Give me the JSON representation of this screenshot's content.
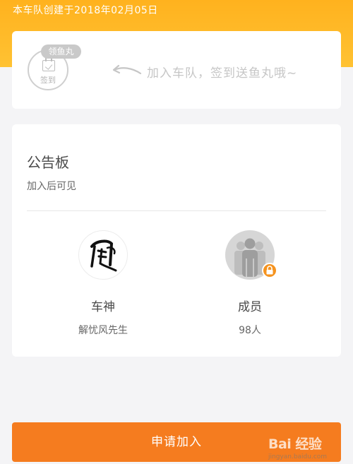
{
  "header": {
    "created_text": "本车队创建于2018年02月05日"
  },
  "checkin": {
    "badge_label": "领鱼丸",
    "icon_label": "签到",
    "hint_text": "加入车队，签到送鱼丸哦~"
  },
  "board": {
    "title": "公告板",
    "subtitle": "加入后可见"
  },
  "stats": {
    "owner": {
      "title": "车神",
      "value": "解忧风先生"
    },
    "members": {
      "title": "成员",
      "value": "98人"
    }
  },
  "action": {
    "apply_label": "申请加入"
  },
  "watermark": {
    "brand": "Bai 经验",
    "url": "jingyan.baidu.com"
  },
  "colors": {
    "header_orange": "#ffb21e",
    "button_orange": "#f57c1f",
    "lock_orange": "#f5931f"
  }
}
